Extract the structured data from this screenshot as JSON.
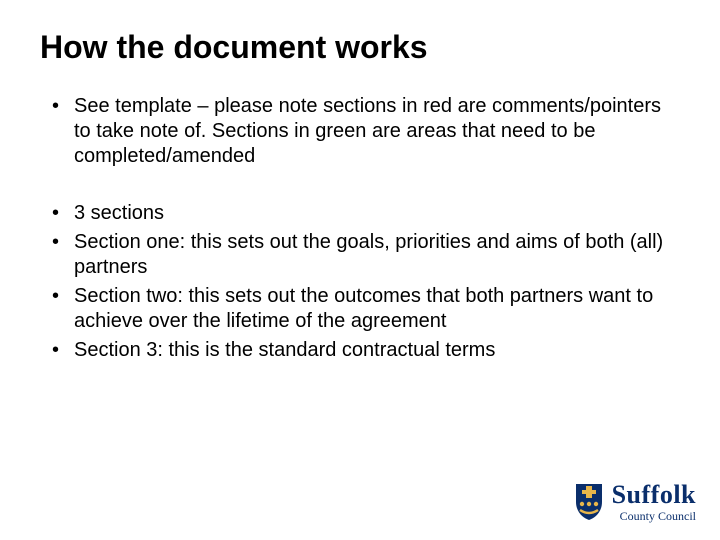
{
  "title": "How the document works",
  "bullets_group1": [
    "See template – please note sections in red are comments/pointers to take note of.  Sections in green are areas that need to be completed/amended"
  ],
  "bullets_group2": [
    "3 sections",
    "Section one: this sets out the goals, priorities and aims of both (all) partners",
    "Section two: this sets out the outcomes that both partners want to achieve over the lifetime of the agreement",
    "Section 3: this is the standard contractual terms"
  ],
  "logo": {
    "main": "Suffolk",
    "sub": "County Council"
  }
}
